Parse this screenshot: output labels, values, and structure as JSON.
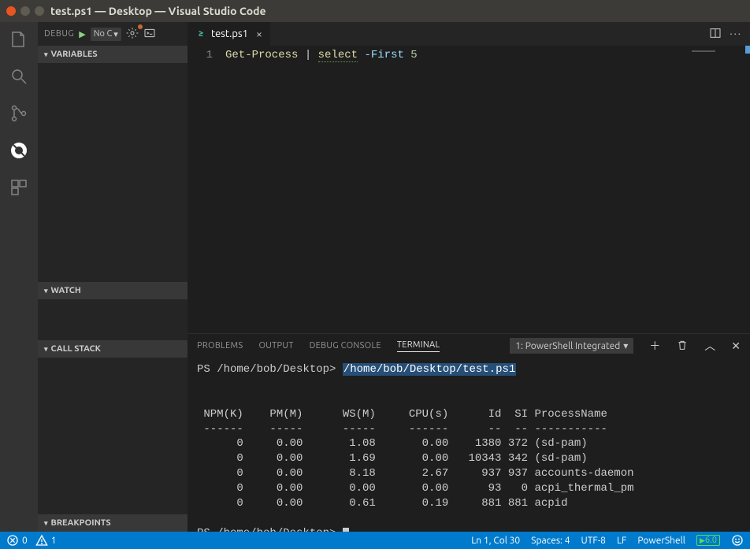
{
  "window": {
    "title": "test.ps1 — Desktop — Visual Studio Code"
  },
  "debug": {
    "label": "DEBUG",
    "config": "No C",
    "sections": {
      "variables": "VARIABLES",
      "watch": "WATCH",
      "callstack": "CALL STACK",
      "breakpoints": "BREAKPOINTS"
    }
  },
  "tabs": {
    "active": {
      "name": "test.ps1"
    }
  },
  "editor": {
    "line_no": "1",
    "tokens": {
      "cmd1": "Get-Process",
      "pipe": " | ",
      "cmd2": "select",
      "param": " -First ",
      "num": "5"
    }
  },
  "panel": {
    "tabs": {
      "problems": "PROBLEMS",
      "output": "OUTPUT",
      "debug_console": "DEBUG CONSOLE",
      "terminal": "TERMINAL"
    },
    "terminal_name": "1: PowerShell Integrated"
  },
  "terminal": {
    "prompt1_prefix": "PS /home/bob/Desktop> ",
    "prompt1_cmd": "/home/bob/Desktop/test.ps1",
    "header": " NPM(K)    PM(M)      WS(M)     CPU(s)      Id  SI ProcessName",
    "divider": " ------    -----      -----     ------      --  -- -----------",
    "rows": [
      "      0     0.00       1.08       0.00    1380 372 (sd-pam)",
      "      0     0.00       1.69       0.00   10343 342 (sd-pam)",
      "      0     0.00       8.18       2.67     937 937 accounts-daemon",
      "      0     0.00       0.00       0.00      93   0 acpi_thermal_pm",
      "      0     0.00       0.61       0.19     881 881 acpid"
    ],
    "prompt2": "PS /home/bob/Desktop> "
  },
  "status": {
    "errors": "0",
    "warnings": "1",
    "ln_col": "Ln 1, Col 30",
    "spaces": "Spaces: 4",
    "encoding": "UTF-8",
    "eol": "LF",
    "language": "PowerShell",
    "ps_version": "6.0"
  }
}
